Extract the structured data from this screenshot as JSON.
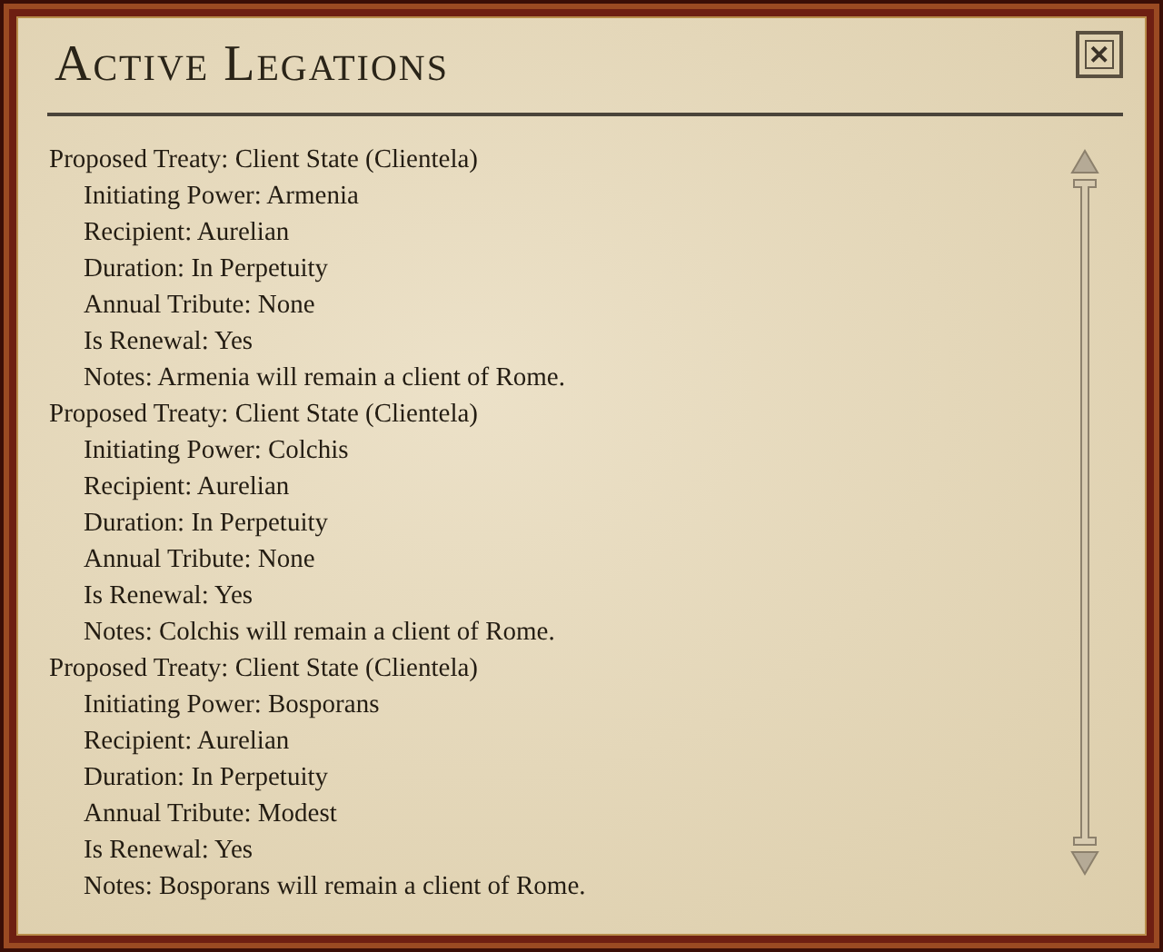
{
  "window": {
    "title": "Active Legations",
    "close": "✕"
  },
  "treaties": [
    {
      "heading": "Proposed Treaty: Client State (Clientela)",
      "details": [
        "Initiating Power: Armenia",
        "Recipient: Aurelian",
        "Duration: In Perpetuity",
        "Annual Tribute: None",
        "Is Renewal: Yes",
        "Notes: Armenia will remain a client of Rome."
      ]
    },
    {
      "heading": "Proposed Treaty: Client State (Clientela)",
      "details": [
        "Initiating Power: Colchis",
        "Recipient: Aurelian",
        "Duration: In Perpetuity",
        "Annual Tribute: None",
        "Is Renewal: Yes",
        "Notes: Colchis will remain a client of Rome."
      ]
    },
    {
      "heading": "Proposed Treaty: Client State (Clientela)",
      "details": [
        "Initiating Power: Bosporans",
        "Recipient: Aurelian",
        "Duration: In Perpetuity",
        "Annual Tribute: Modest",
        "Is Renewal: Yes",
        "Notes: Bosporans will remain a client of Rome."
      ]
    }
  ]
}
